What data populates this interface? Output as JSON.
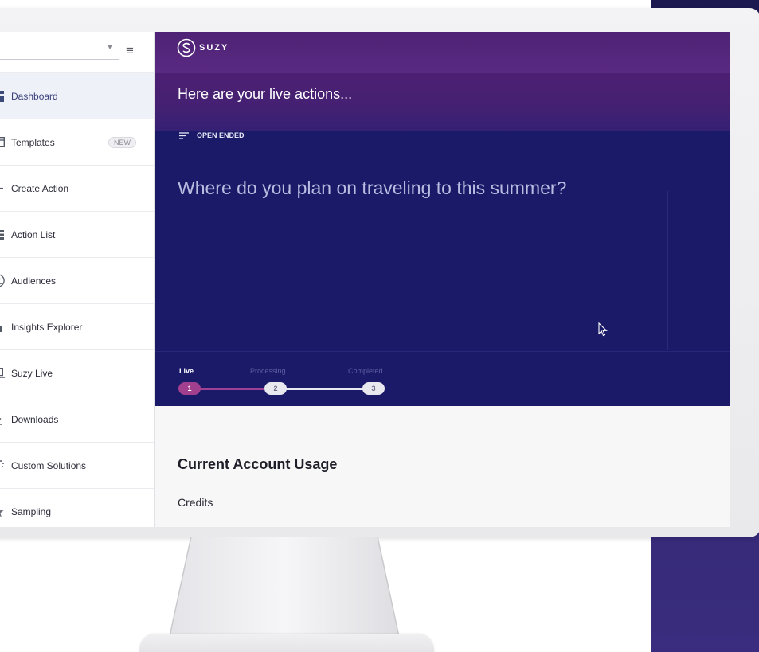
{
  "app": {
    "brand": "SUZY",
    "accent": "#5a2a82",
    "panel_color": "#1b1a68",
    "progress_accent": "#a2408f"
  },
  "sidebar": {
    "items": [
      {
        "label": "Dashboard",
        "icon": "dashboard-icon",
        "active": true
      },
      {
        "label": "Templates",
        "icon": "templates-icon",
        "badge": "NEW"
      },
      {
        "label": "Create Action",
        "icon": "plus-icon"
      },
      {
        "label": "Action List",
        "icon": "list-icon"
      },
      {
        "label": "Audiences",
        "icon": "audiences-icon"
      },
      {
        "label": "Insights Explorer",
        "icon": "bar-chart-icon"
      },
      {
        "label": "Suzy Live",
        "icon": "laptop-icon"
      },
      {
        "label": "Downloads",
        "icon": "download-icon"
      },
      {
        "label": "Custom Solutions",
        "icon": "magic-wand-icon"
      },
      {
        "label": "Sampling",
        "icon": "star-icon"
      }
    ]
  },
  "main": {
    "banner_title": "Here are your live actions...",
    "question_type": "OPEN ENDED",
    "question": "Where do you plan on traveling to this summer?",
    "steps": [
      {
        "label": "Live",
        "number": "1"
      },
      {
        "label": "Processing",
        "number": "2"
      },
      {
        "label": "Completed",
        "number": "3"
      }
    ],
    "usage_title": "Current Account Usage",
    "usage_subtitle": "Credits"
  }
}
